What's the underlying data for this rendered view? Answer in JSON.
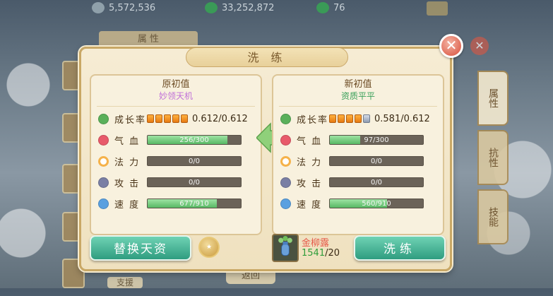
{
  "topbar": {
    "silver": "5,572,536",
    "gold": "33,252,872",
    "jade": "76"
  },
  "underlying": {
    "tab_attr": "属 性",
    "right_tabs": [
      "属性",
      "抗性",
      "技能",
      ""
    ],
    "bottom_btn": "返回",
    "bottom_btn2": "支援"
  },
  "modal": {
    "title": "洗 练",
    "old": {
      "title": "原初值",
      "subtitle": "妙领天机",
      "growth_segments_full": 5,
      "growth_segments_gray": 0,
      "growth_value": "0.612/0.612"
    },
    "new": {
      "title": "新初值",
      "subtitle": "资质平平",
      "growth_segments_full": 4,
      "growth_segments_gray": 1,
      "growth_value": "0.581/0.612"
    },
    "labels": {
      "growth": "成长率",
      "hp": "气 血",
      "mp": "法 力",
      "atk": "攻 击",
      "spd": "速 度"
    },
    "old_stats": {
      "hp": {
        "text": "256/300",
        "fraction": 0.853
      },
      "mp": {
        "text": "0/0",
        "fraction": 0
      },
      "atk": {
        "text": "0/0",
        "fraction": 0
      },
      "spd": {
        "text": "677/910",
        "fraction": 0.744
      }
    },
    "new_stats": {
      "hp": {
        "text": "97/300",
        "fraction": 0.323
      },
      "mp": {
        "text": "0/0",
        "fraction": 0
      },
      "atk": {
        "text": "0/0",
        "fraction": 0
      },
      "spd": {
        "text": "560/910",
        "fraction": 0.615
      }
    },
    "replace_button": "替换天资",
    "wash_button": "洗练",
    "item_name": "金柳露",
    "item_have": "1541",
    "item_need": "/20"
  },
  "watermark": "出凸出云",
  "colors": {
    "hp_icon": "#e85a6a",
    "mp_icon": "#f5b24a",
    "atk_icon": "#7a7fa4",
    "spd_icon": "#5aa0e0",
    "growth_icon": "#5ab05a"
  }
}
